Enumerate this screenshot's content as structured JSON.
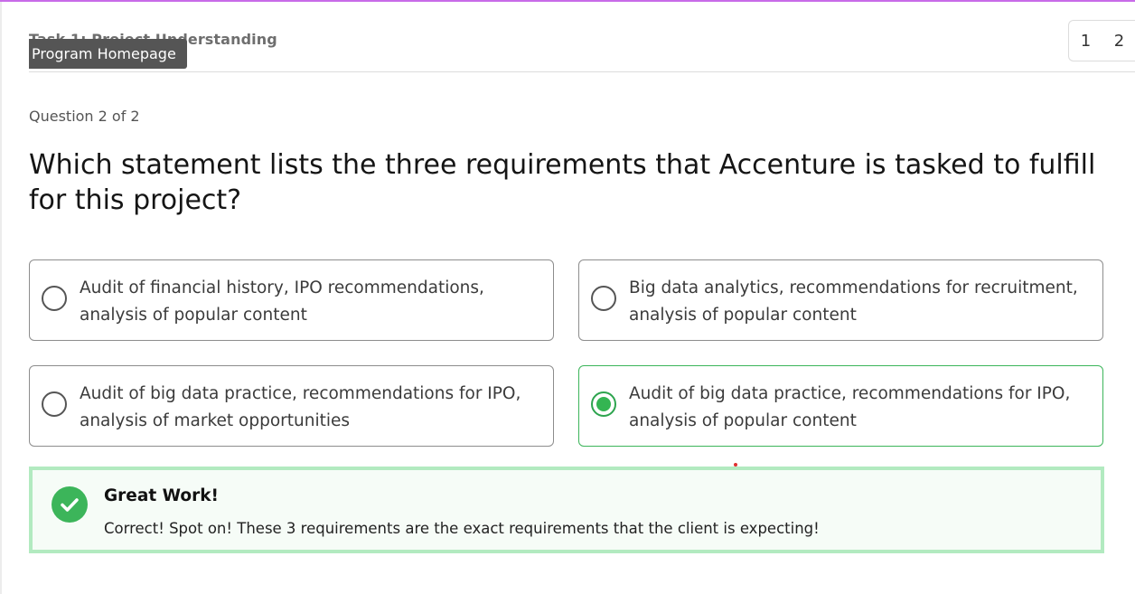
{
  "header": {
    "title": "Task 1: Project Understanding",
    "tooltip": "Program Homepage",
    "pages": [
      "1",
      "2"
    ]
  },
  "question": {
    "counter": "Question 2 of 2",
    "text": "Which statement lists the three requirements that Accenture is tasked to fulfill for this project?",
    "options": [
      {
        "label": "Audit of financial history, IPO recommendations, analysis of popular content",
        "selected": false
      },
      {
        "label": "Big data analytics, recommendations for recruitment, analysis of popular content",
        "selected": false
      },
      {
        "label": "Audit of big data practice, recommendations for IPO, analysis of market opportunities",
        "selected": false
      },
      {
        "label": "Audit of big data practice, recommendations for IPO, analysis of popular content",
        "selected": true
      }
    ]
  },
  "feedback": {
    "title": "Great Work!",
    "message": "Correct! Spot on! These 3 requirements are the exact requirements that the client is expecting!"
  },
  "colors": {
    "accent_top": "#c86be8",
    "success": "#3cb55a",
    "feedback_border": "#b2eac0"
  }
}
